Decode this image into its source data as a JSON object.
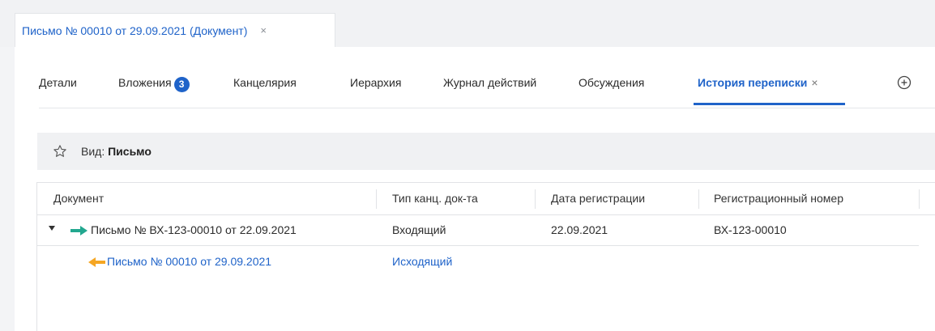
{
  "doc_tab": {
    "title": "Письмо № 00010 от 29.09.2021 (Документ)",
    "close": "×"
  },
  "tabs": [
    {
      "label": "Детали"
    },
    {
      "label": "Вложения",
      "badge": "3"
    },
    {
      "label": "Канцелярия"
    },
    {
      "label": "Иерархия"
    },
    {
      "label": "Журнал действий"
    },
    {
      "label": "Обсуждения"
    },
    {
      "label": "История переписки",
      "close": "×",
      "active": true
    }
  ],
  "view": {
    "label": "Вид:",
    "value": "Письмо"
  },
  "grid": {
    "columns": [
      "Документ",
      "Тип канц. док-та",
      "Дата регистрации",
      "Регистрационный номер"
    ],
    "rows": [
      {
        "document": "Письмо № ВХ-123-00010 от 22.09.2021",
        "type": "Входящий",
        "date": "22.09.2021",
        "reg_number": "ВХ-123-00010",
        "direction": "incoming"
      },
      {
        "document": "Письмо № 00010 от 29.09.2021",
        "type": "Исходящий",
        "date": "",
        "reg_number": "",
        "direction": "outgoing"
      }
    ]
  },
  "colors": {
    "accent": "#1f63c9",
    "incoming_arrow": "#22a78f",
    "outgoing_arrow": "#f5a623"
  }
}
